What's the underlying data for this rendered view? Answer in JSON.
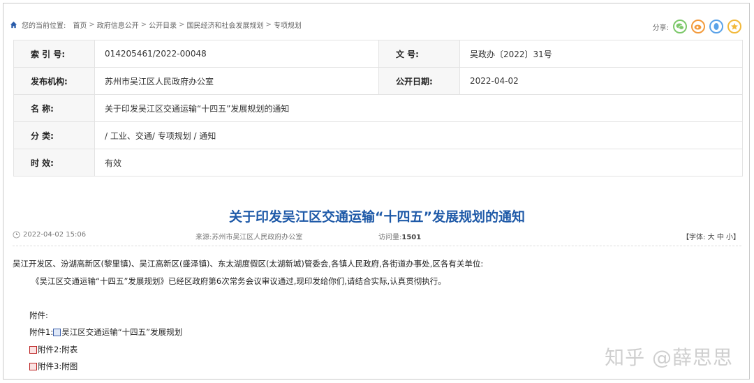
{
  "breadcrumb": {
    "prefix": "您的当前位置:",
    "items": [
      "首页",
      "政府信息公开",
      "公开目录",
      "国民经济和社会发展规划",
      "专项规划"
    ],
    "sep": ">"
  },
  "share": {
    "label": "分享:"
  },
  "meta": {
    "index_label": "索 引 号:",
    "index_value": "014205461/2022-00048",
    "docno_label": "文 号:",
    "docno_value": "吴政办〔2022〕31号",
    "publisher_label": "发布机构:",
    "publisher_value": "苏州市吴江区人民政府办公室",
    "date_label": "公开日期:",
    "date_value": "2022-04-02",
    "name_label": "名 称:",
    "name_value": "关于印发吴江区交通运输“十四五”发展规划的通知",
    "category_label": "分 类:",
    "category_value": "/ 工业、交通/ 专项规划 / 通知",
    "validity_label": "时 效:",
    "validity_value": "有效"
  },
  "article": {
    "title": "关于印发吴江区交通运输“十四五”发展规划的通知",
    "datetime": "2022-04-02 15:06",
    "source": "来源:苏州市吴江区人民政府办公室",
    "views_label": "访问量:",
    "views": "1501",
    "font_label": "【字体:",
    "font_large": "大",
    "font_mid": "中",
    "font_small": "小】"
  },
  "body": {
    "recipients": "吴江开发区、汾湖高新区(黎里镇)、吴江高新区(盛泽镇)、东太湖度假区(太湖新城)管委会,各镇人民政府,各街道办事处,区各有关单位:",
    "para": "《吴江区交通运输“十四五”发展规划》已经区政府第6次常务会议审议通过,现印发给你们,请结合实际,认真贯彻执行。",
    "attach_head": "附件:",
    "att1_prefix": "附件1:",
    "att1": "吴江区交通运输“十四五”发展规划",
    "att2": "附件2:附表",
    "att3": "附件3:附图"
  },
  "watermark": "知乎 @薛思思"
}
